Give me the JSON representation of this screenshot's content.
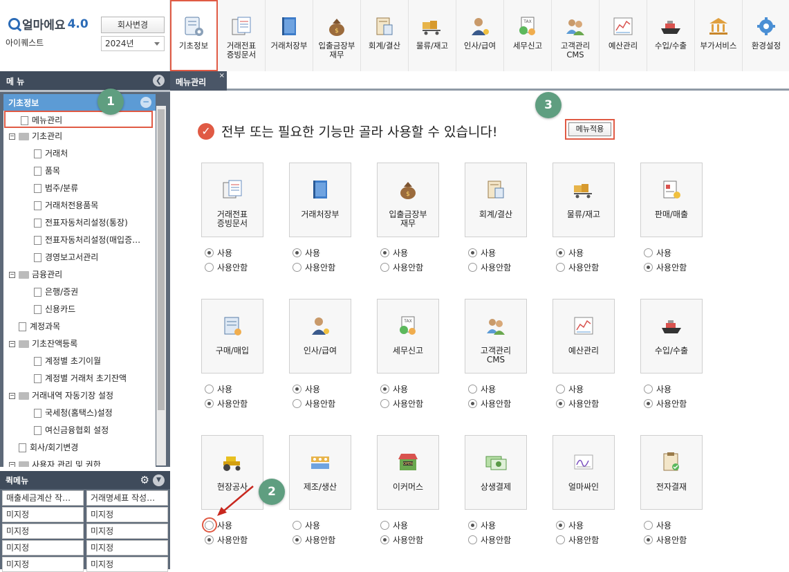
{
  "app": {
    "logo_text": "얼마에요",
    "logo_version": "4.0",
    "company": "아이퀘스트",
    "change_company_label": "회사변경",
    "year": "2024년"
  },
  "toolbar": [
    {
      "label": "기초정보",
      "icon": "settings-doc-icon",
      "selected": true
    },
    {
      "label": "거래전표\n증빙문서",
      "icon": "voucher-icon"
    },
    {
      "label": "거래처장부",
      "icon": "ledger-book-icon"
    },
    {
      "label": "입출금장부\n재무",
      "icon": "money-bag-icon"
    },
    {
      "label": "회계/결산",
      "icon": "accounting-icon"
    },
    {
      "label": "물류/재고",
      "icon": "logistics-cart-icon"
    },
    {
      "label": "인사/급여",
      "icon": "hr-person-icon"
    },
    {
      "label": "세무신고",
      "icon": "tax-icon"
    },
    {
      "label": "고객관리\nCMS",
      "icon": "customers-icon"
    },
    {
      "label": "예산관리",
      "icon": "budget-chart-icon"
    },
    {
      "label": "수입/수출",
      "icon": "ship-icon"
    },
    {
      "label": "부가서비스",
      "icon": "bank-icon"
    },
    {
      "label": "환경설정",
      "icon": "gear-icon"
    }
  ],
  "sidebar": {
    "title": "메 뉴",
    "section": "기초정보",
    "items": [
      {
        "label": "메뉴관리",
        "type": "doc",
        "level": 1,
        "active": true
      },
      {
        "label": "기초관리",
        "type": "folder",
        "level": 1
      },
      {
        "label": "거래처",
        "type": "doc",
        "level": 2
      },
      {
        "label": "품목",
        "type": "doc",
        "level": 2
      },
      {
        "label": "범주/분류",
        "type": "doc",
        "level": 2
      },
      {
        "label": "거래처전용품목",
        "type": "doc",
        "level": 2
      },
      {
        "label": "전표자동처리설정(통장)",
        "type": "doc",
        "level": 2
      },
      {
        "label": "전표자동처리설정(매입증…",
        "type": "doc",
        "level": 2
      },
      {
        "label": "경영보고서관리",
        "type": "doc",
        "level": 2
      },
      {
        "label": "금융관리",
        "type": "folder",
        "level": 1
      },
      {
        "label": "은행/증권",
        "type": "doc",
        "level": 2
      },
      {
        "label": "신용카드",
        "type": "doc",
        "level": 2
      },
      {
        "label": "계정과목",
        "type": "doc",
        "level": 1
      },
      {
        "label": "기초잔액등록",
        "type": "folder",
        "level": 1
      },
      {
        "label": "계정별 초기이월",
        "type": "doc",
        "level": 2
      },
      {
        "label": "계정별 거래처 초기잔액",
        "type": "doc",
        "level": 2
      },
      {
        "label": "거래내역 자동기장 설정",
        "type": "folder",
        "level": 1
      },
      {
        "label": "국세청(홈택스)설정",
        "type": "doc",
        "level": 2
      },
      {
        "label": "여신금융협회 설정",
        "type": "doc",
        "level": 2
      },
      {
        "label": "회사/회기변경",
        "type": "doc",
        "level": 1
      },
      {
        "label": "사용자 관리 및 권한",
        "type": "folder",
        "level": 1
      }
    ]
  },
  "quick_menu": {
    "title": "퀵메뉴",
    "cells": [
      "매출세금계산 작…",
      "거래명세표 작성…",
      "미지정",
      "미지정",
      "미지정",
      "미지정",
      "미지정",
      "미지정",
      "미지정",
      "미지정"
    ]
  },
  "tab": {
    "label": "메뉴관리",
    "close": "×"
  },
  "main": {
    "headline": "전부 또는 필요한 기능만 골라 사용할 수 있습니다!",
    "apply_label": "메뉴적용",
    "use_label": "사용",
    "unuse_label": "사용안함",
    "cards": [
      {
        "label": "거래전표\n증빙문서",
        "icon": "voucher-icon",
        "use": true
      },
      {
        "label": "거래처장부",
        "icon": "ledger-book-icon",
        "use": true
      },
      {
        "label": "입출금장부\n재무",
        "icon": "money-bag-icon",
        "use": true
      },
      {
        "label": "회계/결산",
        "icon": "accounting-icon",
        "use": true
      },
      {
        "label": "물류/재고",
        "icon": "logistics-cart-icon",
        "use": true
      },
      {
        "label": "판매/매출",
        "icon": "sales-icon",
        "use": false
      },
      {
        "label": "구매/매입",
        "icon": "purchase-icon",
        "use": false
      },
      {
        "label": "인사/급여",
        "icon": "hr-person-icon",
        "use": true
      },
      {
        "label": "세무신고",
        "icon": "tax-icon",
        "use": true
      },
      {
        "label": "고객관리\nCMS",
        "icon": "customers-icon",
        "use": false
      },
      {
        "label": "예산관리",
        "icon": "budget-chart-icon",
        "use": false
      },
      {
        "label": "수입/수출",
        "icon": "ship-icon",
        "use": false
      },
      {
        "label": "현장공사",
        "icon": "tractor-icon",
        "use": false
      },
      {
        "label": "제조/생산",
        "icon": "factory-icon",
        "use": false
      },
      {
        "label": "이커머스",
        "icon": "shop-icon",
        "use": false
      },
      {
        "label": "상생결제",
        "icon": "payment-icon",
        "use": true
      },
      {
        "label": "얼마싸인",
        "icon": "signature-icon",
        "use": true
      },
      {
        "label": "전자결재",
        "icon": "approval-icon",
        "use": false
      }
    ]
  },
  "badges": [
    "1",
    "2",
    "3"
  ],
  "colors": {
    "accent_red": "#e05a44",
    "sidebar_dark": "#3f4b5b",
    "tree_header_blue": "#5c9bd5",
    "badge_green": "#5f9e80"
  }
}
